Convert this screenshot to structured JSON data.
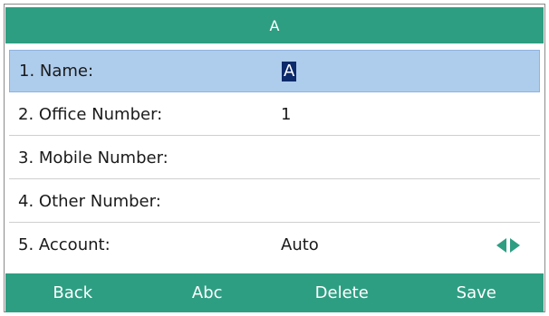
{
  "header": {
    "title": "A"
  },
  "fields": [
    {
      "label": "1. Name:",
      "value": "A"
    },
    {
      "label": "2. Office Number:",
      "value": "1"
    },
    {
      "label": "3. Mobile Number:",
      "value": ""
    },
    {
      "label": "4. Other Number:",
      "value": ""
    },
    {
      "label": "5. Account:",
      "value": "Auto"
    }
  ],
  "softkeys": {
    "back": "Back",
    "abc": "Abc",
    "delete": "Delete",
    "save": "Save"
  },
  "icons": {
    "left": "arrow-left-icon",
    "right": "arrow-right-icon"
  },
  "colors": {
    "accent": "#2e9e82",
    "selection": "#aeccec",
    "cursor": "#0d2a6b"
  }
}
